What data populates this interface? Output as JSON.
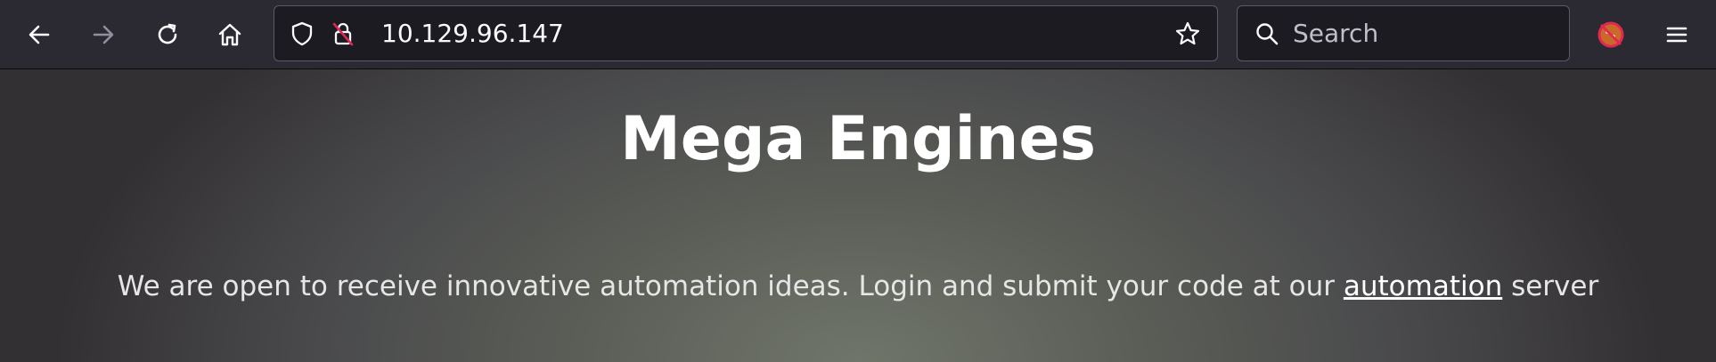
{
  "toolbar": {
    "back_icon": "arrow-left-icon",
    "forward_icon": "arrow-right-icon",
    "reload_icon": "reload-icon",
    "home_icon": "home-icon",
    "menu_icon": "hamburger-menu-icon",
    "extension_icon": "extension-icon"
  },
  "urlbar": {
    "url": "10.129.96.147",
    "shield_icon": "shield-icon",
    "insecure_icon": "insecure-lock-icon",
    "bookmark_icon": "star-icon"
  },
  "search": {
    "placeholder": "Search"
  },
  "page": {
    "title": "Mega Engines",
    "intro_before": "We are open to receive innovative automation ideas. Login and submit your code at our ",
    "link_text": "automation",
    "intro_after": " server"
  },
  "colors": {
    "toolbar_bg": "#2b2a33",
    "field_bg": "#1c1b22",
    "text_light": "#fbfbfe",
    "title": "#ffffff"
  }
}
